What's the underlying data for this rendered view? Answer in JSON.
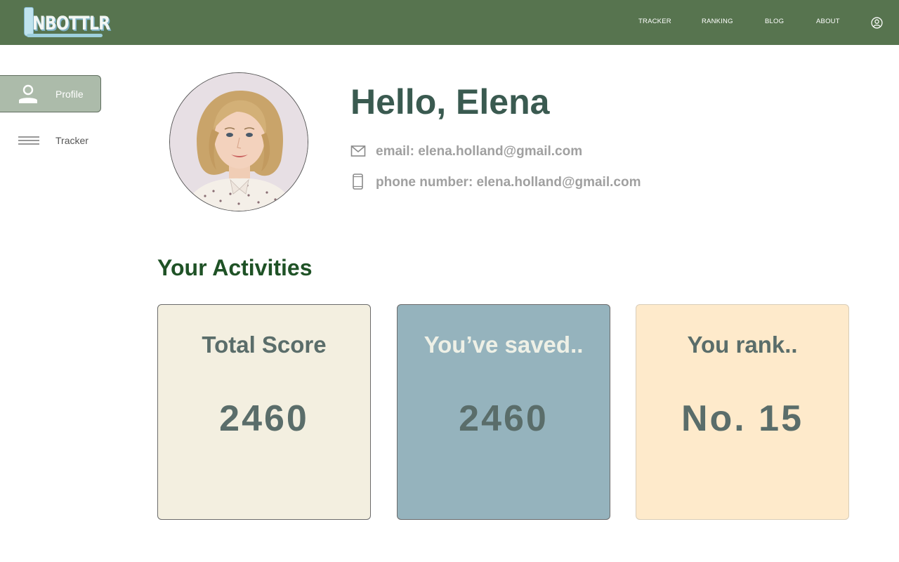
{
  "header": {
    "logo_text": "NBOTTLR",
    "nav": [
      "TRACKER",
      "RANKING",
      "BLOG",
      "ABOUT"
    ],
    "account_icon": "account-circle-icon",
    "background": "#57744f"
  },
  "sidebar": {
    "items": [
      {
        "label": "Profile",
        "icon": "person-icon",
        "active": true
      },
      {
        "label": "Tracker",
        "icon": "list-lines-icon",
        "active": false
      }
    ]
  },
  "profile": {
    "greeting": "Hello, Elena",
    "email": "email: elena.holland@gmail.com",
    "phone": "phone number: elena.holland@gmail.com"
  },
  "activities": {
    "title": "Your Activities",
    "cards": [
      {
        "title": "Total Score",
        "value": "2460",
        "color": "#f3efe0"
      },
      {
        "title": "You’ve saved..",
        "value": "2460",
        "color": "#95b3bd"
      },
      {
        "title": "You rank..",
        "value": "No. 15",
        "color": "#feeacb"
      }
    ]
  }
}
